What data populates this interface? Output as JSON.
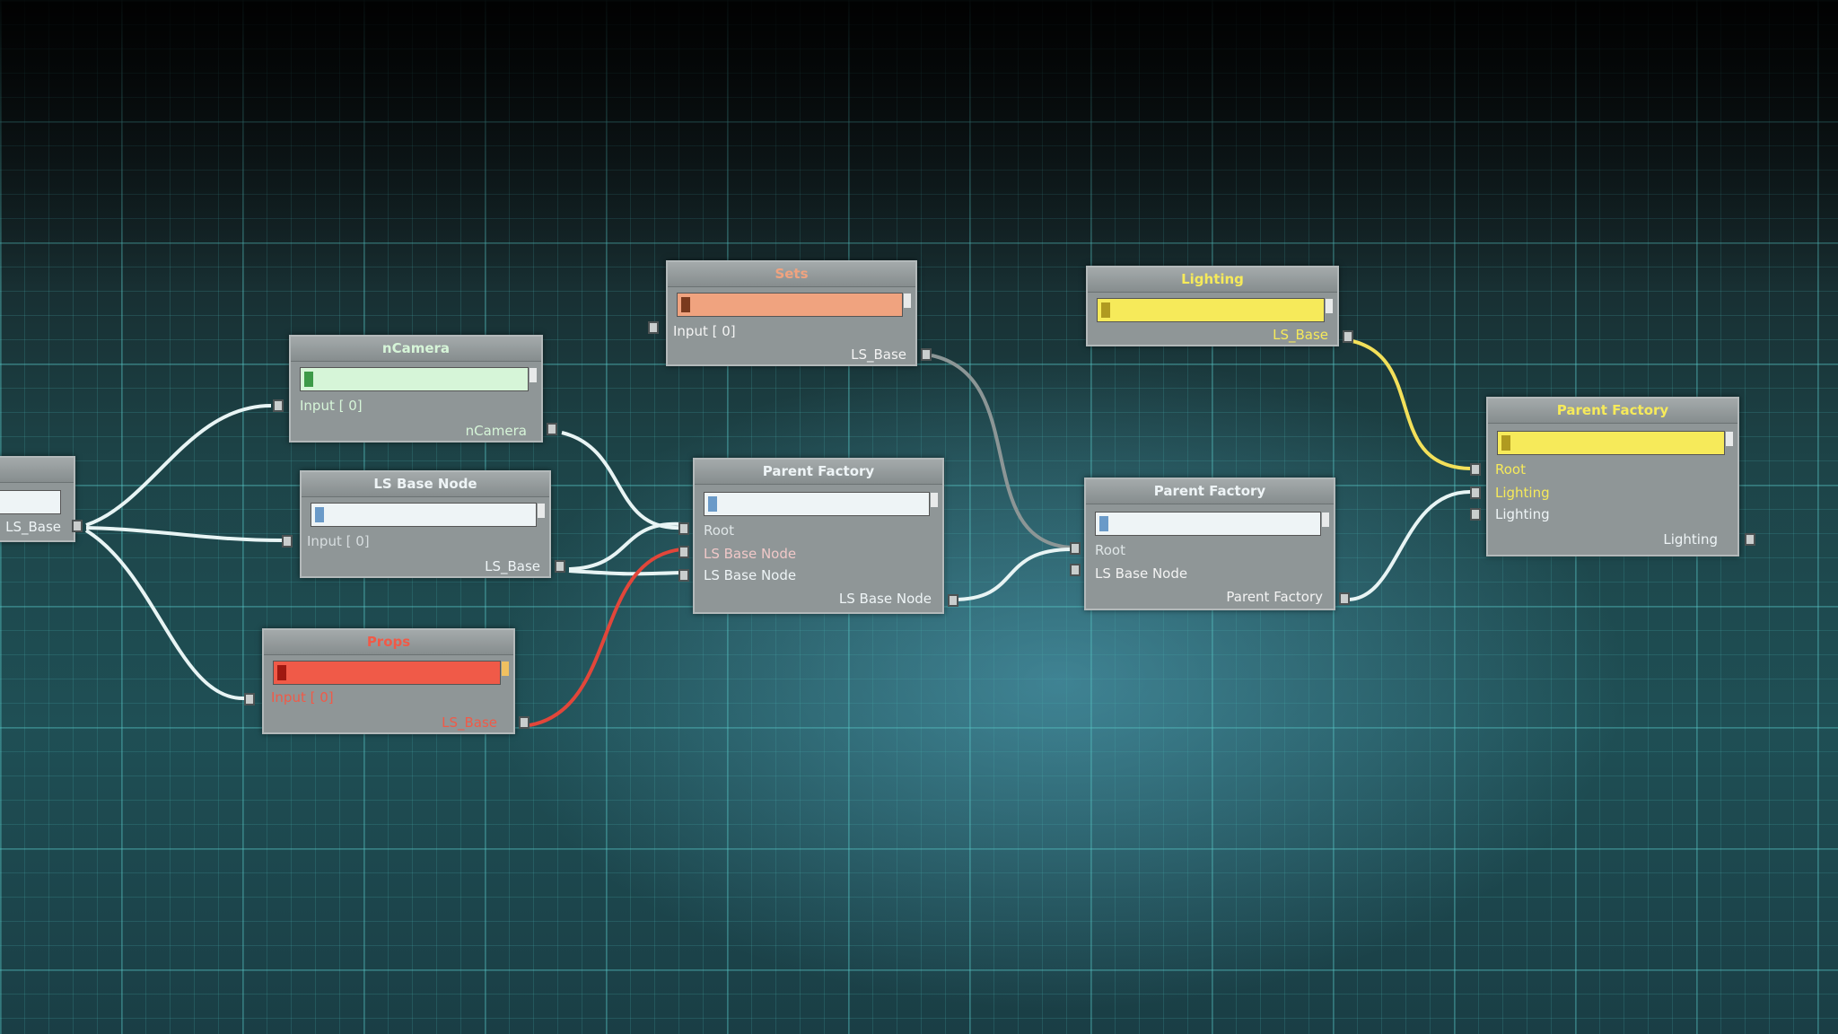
{
  "colors": {
    "white_node": "#eef4f6",
    "green_node": "#d6f5d8",
    "salmon_node": "#f0a37f",
    "red_node": "#f05a48",
    "yellow_node": "#f6ea5a",
    "wire_white": "#e8f4f4",
    "wire_gray": "#8c9696",
    "wire_red": "#e2463a",
    "wire_yellow": "#f3e05a"
  },
  "nodes": {
    "ls_base_left": {
      "out": "LS_Base"
    },
    "ncamera": {
      "title": "nCamera",
      "in1": "Input [ 0]",
      "out": "nCamera"
    },
    "ls_base_node": {
      "title": "LS Base Node",
      "in1": "Input [ 0]",
      "out": "LS_Base"
    },
    "props": {
      "title": "Props",
      "in1": "Input [ 0]",
      "out": "LS_Base"
    },
    "sets": {
      "title": "Sets",
      "in1": "Input [ 0]",
      "out": "LS_Base"
    },
    "parent_factory_1": {
      "title": "Parent Factory",
      "in1": "Root",
      "in2": "LS Base Node",
      "in3": "LS Base Node",
      "out": "LS Base Node"
    },
    "lighting": {
      "title": "Lighting",
      "out": "LS_Base"
    },
    "parent_factory_2": {
      "title": "Parent Factory",
      "in1": "Root",
      "in2": "LS Base Node",
      "out": "Parent Factory"
    },
    "parent_factory_3": {
      "title": "Parent Factory",
      "in1": "Root",
      "in2": "Lighting",
      "in3": "Lighting",
      "out": "Lighting"
    }
  }
}
